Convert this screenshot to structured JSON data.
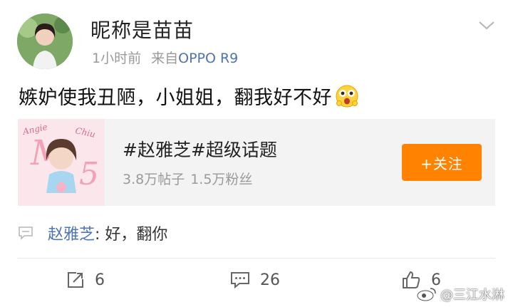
{
  "post": {
    "nickname": "昵称是苗苗",
    "time": "1小时前",
    "source_prefix": "来自",
    "device": "OPPO R9",
    "text": "嫉妒使我丑陋，小姐姐，翻我好不好",
    "emoji": "surprised-face-emoji"
  },
  "topic_card": {
    "title": "#赵雅芝#超级话题",
    "posts": "3.8万帖子",
    "fans": "1.5万粉丝",
    "follow_label": "+关注",
    "image_logo_text": "Angie Chiu"
  },
  "comment": {
    "user": "赵雅芝",
    "text": ": 好，翻你"
  },
  "actions": {
    "repost_count": "6",
    "comment_count": "26",
    "like_count": "6"
  },
  "watermark": {
    "text": "@三江水淋"
  },
  "colors": {
    "accent_orange": "#ff8200",
    "link_blue": "#4d74b3",
    "muted_gray": "#9a9a9a",
    "card_bg": "#f3f3f3"
  }
}
